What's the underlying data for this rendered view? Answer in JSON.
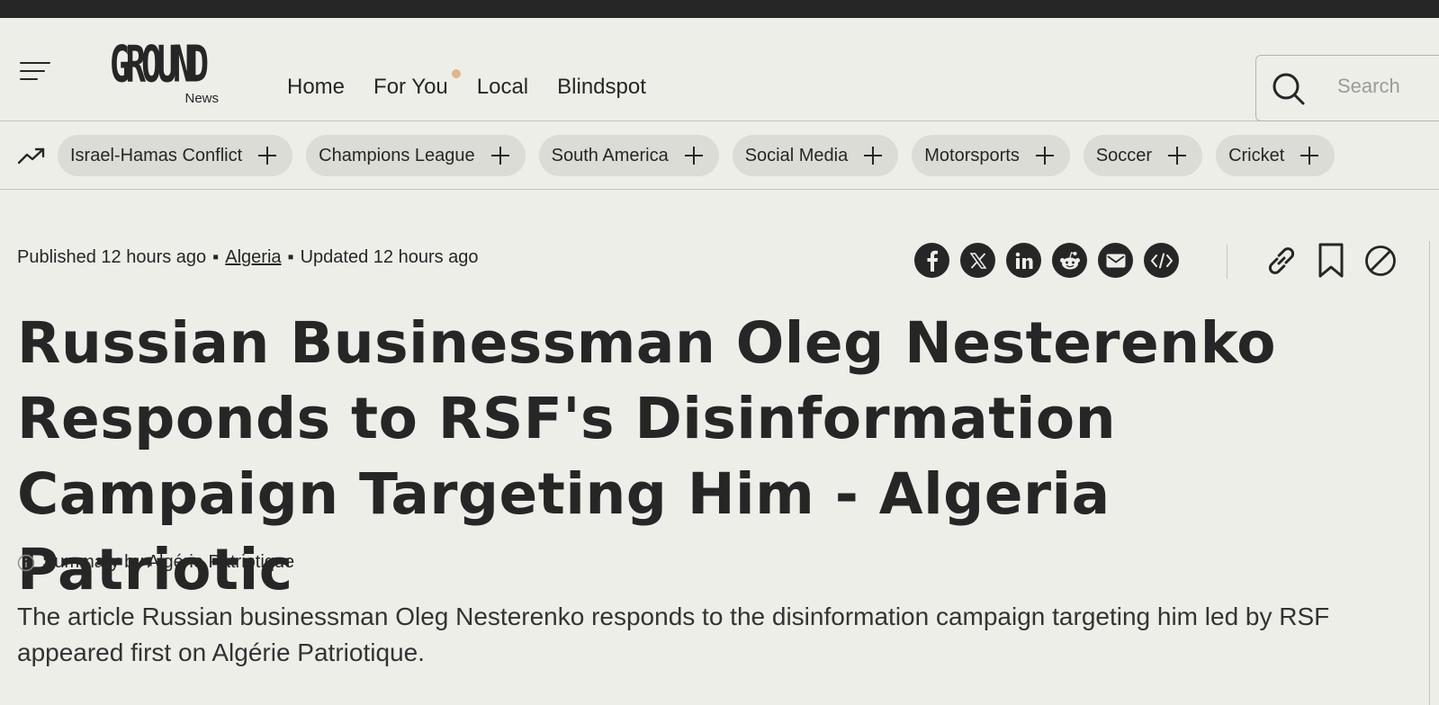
{
  "header": {
    "logo": {
      "word": "GROUND",
      "sub": "News"
    },
    "nav": [
      "Home",
      "For You",
      "Local",
      "Blindspot"
    ],
    "search_placeholder": "Search"
  },
  "topics": [
    "Israel-Hamas Conflict",
    "Champions League",
    "South America",
    "Social Media",
    "Motorsports",
    "Soccer",
    "Cricket"
  ],
  "article": {
    "published": "Published 12 hours ago",
    "location": "Algeria",
    "updated": "Updated 12 hours ago",
    "title": "Russian Businessman Oleg Nesterenko Responds to RSF's Disinformation Campaign Targeting Him - Algeria Patriotic",
    "summary_by": "Summary by Algérie Patriotique",
    "body": "The article Russian businessman Oleg Nesterenko responds to the disinformation campaign targeting him led by RSF appeared first on Algérie Patriotique."
  },
  "share_icons": [
    "facebook-icon",
    "x-icon",
    "linkedin-icon",
    "reddit-icon",
    "email-icon",
    "embed-icon"
  ],
  "tool_icons": [
    "link-icon",
    "bookmark-icon",
    "block-icon"
  ],
  "colors": {
    "background": "#eeeee9",
    "text": "#262626",
    "chip": "#dcdcd6",
    "notification_dot": "#e0b68c",
    "top_bar": "#262626"
  }
}
